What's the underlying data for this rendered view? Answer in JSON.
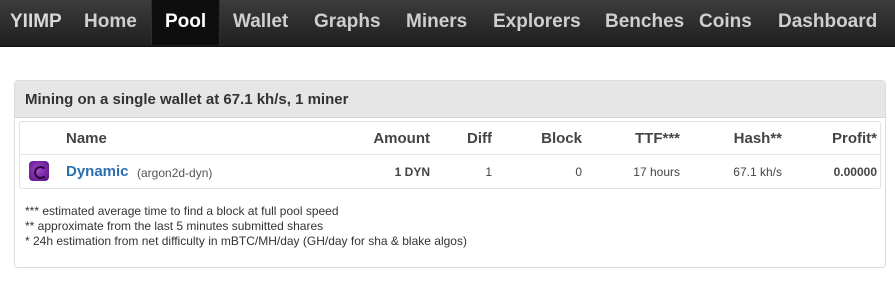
{
  "nav": {
    "brand": "YIIMP",
    "items": [
      "Home",
      "Pool",
      "Wallet",
      "Graphs",
      "Miners",
      "Explorers",
      "Benches",
      "Coins",
      "Dashboard"
    ],
    "active": "Pool"
  },
  "panel": {
    "title": "Mining on a single wallet at 67.1 kh/s, 1 miner",
    "columns": [
      "Name",
      "Amount",
      "Diff",
      "Block",
      "TTF***",
      "Hash**",
      "Profit*"
    ],
    "row": {
      "icon": "dynamic-coin-icon",
      "name": "Dynamic",
      "algo": "(argon2d-dyn)",
      "amount": "1 DYN",
      "diff": "1",
      "block": "0",
      "ttf": "17 hours",
      "hash": "67.1 kh/s",
      "profit": "0.00000"
    },
    "footnotes": [
      "*** estimated average time to find a block at full pool speed",
      "** approximate from the last 5 minutes submitted shares",
      "* 24h estimation from net difficulty in mBTC/MH/day (GH/day for sha & blake algos)"
    ]
  },
  "colors": {
    "navbar": "#2a2a2a",
    "nav_active": "#0e0e0e",
    "link": "#2a6fb0",
    "panel_header": "#e6e6e6",
    "coin_icon": "#7a2aa8"
  }
}
